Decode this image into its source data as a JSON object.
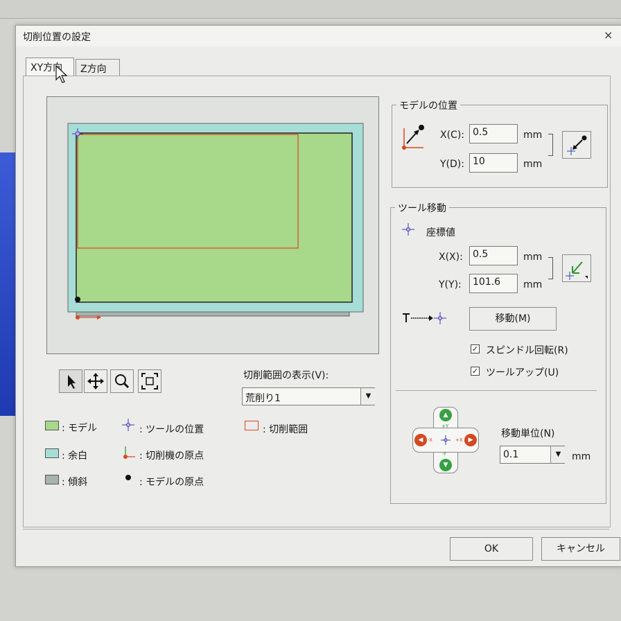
{
  "window": {
    "title": "切削位置の設定",
    "close": "×"
  },
  "tabs": [
    {
      "label": "XY方向"
    },
    {
      "label": "Z方向"
    }
  ],
  "model_position": {
    "group_label": "モデルの位置",
    "x_label": "X(C):",
    "x_value": "0.5",
    "y_label": "Y(D):",
    "y_value": "10",
    "unit": "mm"
  },
  "tool_move": {
    "group_label": "ツール移動",
    "coord_label": "座標値",
    "x_label": "X(X):",
    "x_value": "0.5",
    "y_label": "Y(Y):",
    "y_value": "101.6",
    "unit": "mm",
    "move_button": "移動(M)",
    "spindle_label": "スピンドル回転(R)",
    "spindle_checked": "✓",
    "toolup_label": "ツールアップ(U)",
    "toolup_checked": "✓",
    "step_label": "移動単位(N)",
    "step_value": "0.1",
    "step_unit": "mm",
    "pad_labels": {
      "plus_y": "+Y",
      "minus_y": "-Y",
      "minus_x": "-X",
      "plus_x": "+X"
    }
  },
  "cut_range": {
    "label": "切削範囲の表示(V):",
    "value": "荒削り1"
  },
  "legend": {
    "model": ": モデル",
    "margin": ": 余白",
    "slope": ": 傾斜",
    "tool_pos": ": ツールの位置",
    "machine_origin": ": 切削機の原点",
    "model_origin": ": モデルの原点",
    "cut_range": ": 切削範囲"
  },
  "footer": {
    "ok": "OK",
    "cancel": "キャンセル"
  },
  "colors": {
    "model": "#a8d88a",
    "margin": "#a6ddd6",
    "slope": "#a7b3ad",
    "cut_range": "#d9471f",
    "tool": "#2b45b8"
  }
}
